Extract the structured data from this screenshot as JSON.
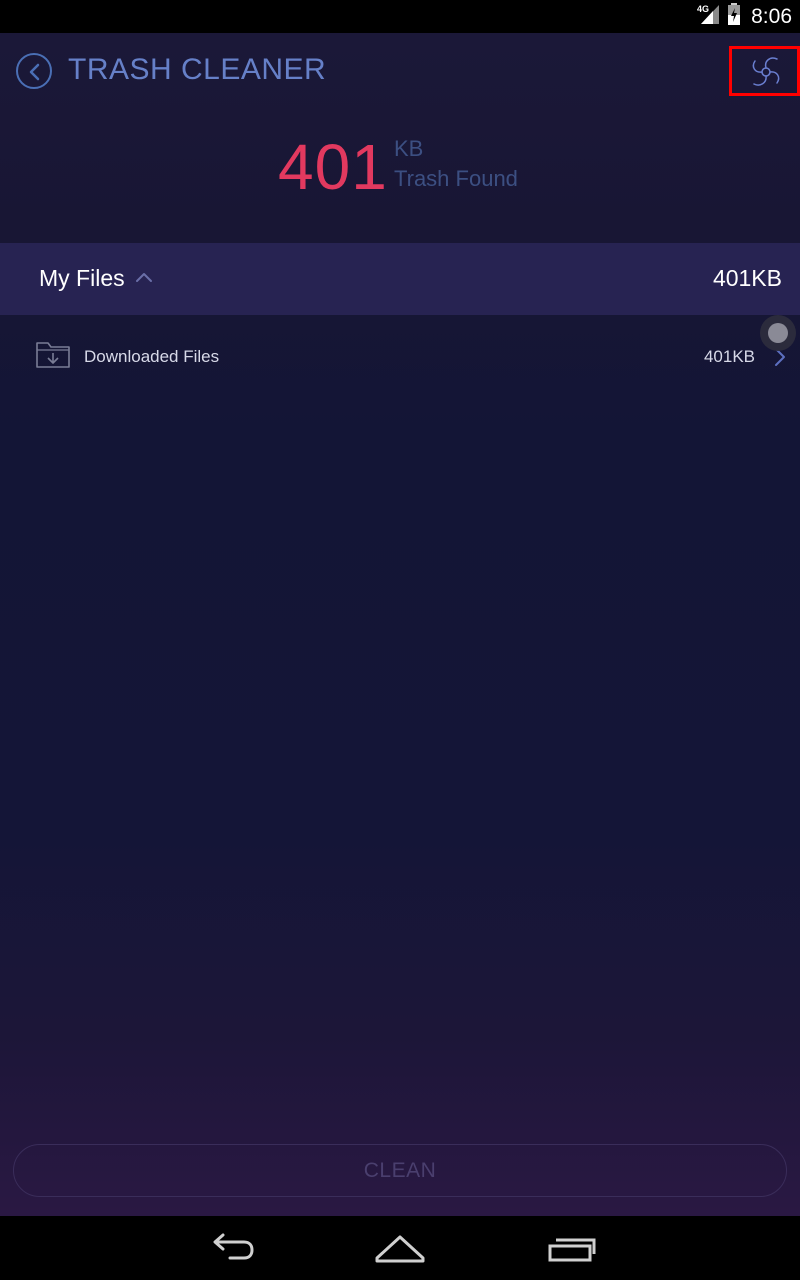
{
  "status_bar": {
    "network": "4G",
    "time": "8:06",
    "icons": [
      "signal-icon",
      "battery-icon"
    ]
  },
  "header": {
    "title": "TRASH CLEANER",
    "back_icon": "back-arrow-icon",
    "settings_icon": "fan-icon"
  },
  "summary": {
    "amount": "401",
    "unit": "KB",
    "label": "Trash Found"
  },
  "group": {
    "title": "My Files",
    "size": "401KB",
    "expanded": true
  },
  "items": [
    {
      "label": "Downloaded Files",
      "size": "401KB",
      "icon": "download-folder-icon"
    }
  ],
  "clean_button": {
    "label": "CLEAN"
  },
  "nav": {
    "buttons": [
      "back-icon",
      "home-icon",
      "recent-apps-icon"
    ]
  },
  "colors": {
    "accent": "#e2395f",
    "title": "#6680c8",
    "group_bg": "#272352",
    "highlight_box": "#ff0000"
  }
}
